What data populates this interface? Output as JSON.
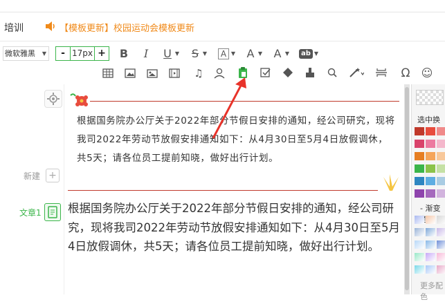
{
  "nav": {
    "tab": "培训",
    "notice": "【模板更新】校园运动会模板更新"
  },
  "toolbar": {
    "font_family": "微软雅黑",
    "font_size": "17px",
    "minus": "-",
    "plus": "+",
    "bold": "B",
    "italic": "I",
    "underline": "U",
    "strike": "S",
    "border": "A",
    "fontcolor": "A",
    "highlight": "A",
    "ab": "ab"
  },
  "sidebar": {
    "new_label": "新建",
    "article_label": "文章1"
  },
  "editor": {
    "template_text": "根据国务院办公厅关于2022年部分节假日安排的通知，经公司研究，现将我司2022年劳动节放假安排通知如下：从4月30日至5月4日放假调休，共5天；请各位员工提前知晓，做好出行计划。",
    "main_text": "根据国务院办公厅关于2022年部分节假日安排的通知，经公司研究，现将我司2022年劳动节放假安排通知如下：从4月30日至5月4日放假调休，共5天；请各位员工提前知晓，做好出行计划。"
  },
  "right_panel": {
    "label1": "选中换色",
    "label2": "- 渐变色",
    "label3": "更多配色"
  },
  "colors": {
    "accent": "#3bb54a",
    "notice": "#f08a1a",
    "rule": "#c0392b",
    "arrow": "#e8332a"
  }
}
